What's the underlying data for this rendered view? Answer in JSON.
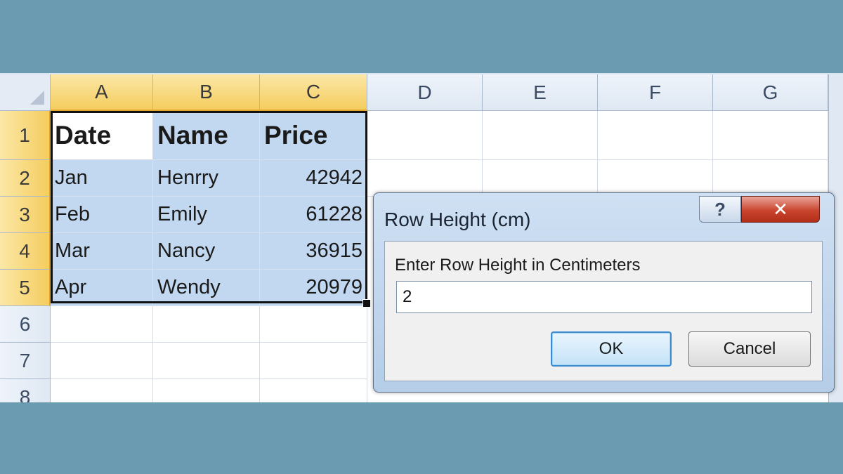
{
  "columns": [
    "A",
    "B",
    "C",
    "D",
    "E",
    "F",
    "G"
  ],
  "rows": [
    "1",
    "2",
    "3",
    "4",
    "5",
    "6",
    "7",
    "8"
  ],
  "table": {
    "headers": [
      "Date",
      "Name",
      "Price"
    ],
    "records": [
      [
        "Jan",
        "Henrry",
        "42942"
      ],
      [
        "Feb",
        "Emily",
        "61228"
      ],
      [
        "Mar",
        "Nancy",
        "36915"
      ],
      [
        "Apr",
        "Wendy",
        "20979"
      ]
    ]
  },
  "dialog": {
    "title": "Row Height (cm)",
    "help_label": "?",
    "close_label": "✕",
    "prompt": "Enter Row Height in Centimeters",
    "input_value": "2",
    "ok_label": "OK",
    "cancel_label": "Cancel"
  },
  "colors": {
    "background": "#6a9bb1",
    "selection_fill": "#c2d8f0",
    "header_selected": "#f5cd5f"
  }
}
